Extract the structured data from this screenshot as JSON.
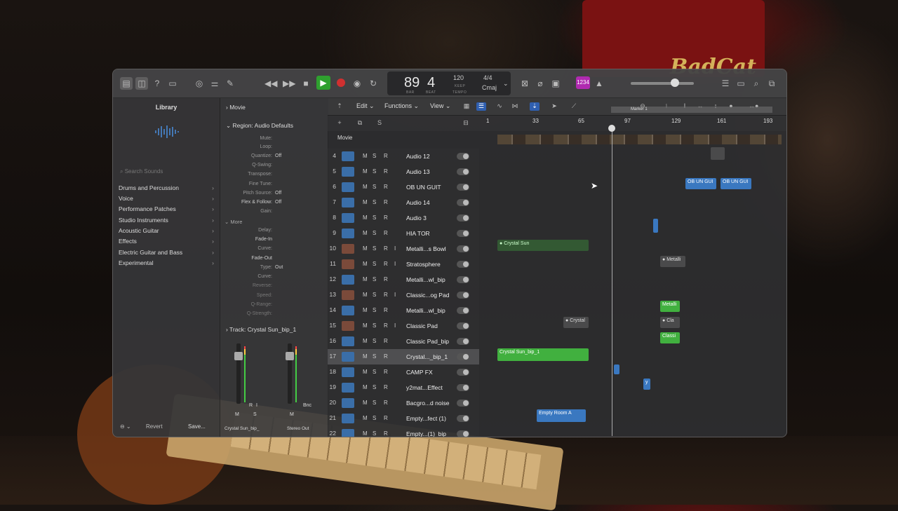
{
  "transport": {
    "bar": "89",
    "beat": "4",
    "bar_caption": "BAR",
    "beat_caption": "BEAT",
    "tempo": "120",
    "keep_label": "KEEP",
    "tempo_caption": "TEMPO",
    "signature": "4/4",
    "key": "Cmaj",
    "badge": "1234"
  },
  "library": {
    "title": "Library",
    "search_placeholder": "Search Sounds",
    "items": [
      "Drums and Percussion",
      "Voice",
      "Performance Patches",
      "Studio Instruments",
      "Acoustic Guitar",
      "Effects",
      "Electric Guitar and Bass",
      "Experimental"
    ],
    "revert": "Revert",
    "save": "Save..."
  },
  "inspector": {
    "movie": "Movie",
    "region": "Region: Audio Defaults",
    "fields": [
      {
        "label": "Mute:",
        "value": ""
      },
      {
        "label": "Loop:",
        "value": ""
      },
      {
        "label": "Quantize:",
        "value": "Off"
      },
      {
        "label": "Q-Swing:",
        "value": ""
      },
      {
        "label": "Transpose:",
        "value": ""
      },
      {
        "label": "Fine Tune:",
        "value": ""
      },
      {
        "label": "Pitch Source:",
        "value": "Off"
      },
      {
        "label": "Flex & Follow:",
        "value": "Off"
      },
      {
        "label": "Gain:",
        "value": ""
      }
    ],
    "more": "More",
    "more_fields": [
      {
        "label": "Delay:",
        "value": ""
      },
      {
        "label": "Fade-In",
        "value": ""
      },
      {
        "label": "Curve:",
        "value": ""
      },
      {
        "label": "Fade-Out",
        "value": ""
      },
      {
        "label": "Type:",
        "value": "Out"
      },
      {
        "label": "Curve:",
        "value": ""
      },
      {
        "label": "Reverse:",
        "value": ""
      },
      {
        "label": "Speed:",
        "value": ""
      },
      {
        "label": "Q-Range:",
        "value": ""
      },
      {
        "label": "Q-Strength:",
        "value": ""
      }
    ],
    "track": "Track:",
    "track_name": "Crystal Sun_bip_1",
    "strip_r": "R",
    "strip_i": "I",
    "strip_m": "M",
    "strip_s": "S",
    "strip_bnc": "Bnc",
    "strip_m2": "M",
    "strip_left_name": "Crystal Sun_bip_",
    "strip_right_name": "Stereo Out"
  },
  "tracks_toolbar": {
    "edit": "Edit",
    "functions": "Functions",
    "view": "View",
    "s": "S"
  },
  "ruler": {
    "marks": [
      "1",
      "33",
      "65",
      "97",
      "129",
      "161",
      "193"
    ],
    "marker": "Marker 1"
  },
  "movie_track": "Movie",
  "tracks": [
    {
      "num": "4",
      "name": "Audio 12",
      "type": "audio",
      "i": false
    },
    {
      "num": "5",
      "name": "Audio 13",
      "type": "audio",
      "i": false
    },
    {
      "num": "6",
      "name": "OB UN GUIT",
      "type": "audio",
      "i": false
    },
    {
      "num": "7",
      "name": "Audio 14",
      "type": "audio",
      "i": false
    },
    {
      "num": "8",
      "name": "Audio 3",
      "type": "audio",
      "i": false
    },
    {
      "num": "9",
      "name": "HIA TOR",
      "type": "audio",
      "i": false
    },
    {
      "num": "10",
      "name": "Metalli...s Bowl",
      "type": "inst",
      "i": true
    },
    {
      "num": "11",
      "name": "Stratosphere",
      "type": "inst",
      "i": true
    },
    {
      "num": "12",
      "name": "Metalli...wl_bip",
      "type": "audio",
      "i": false
    },
    {
      "num": "13",
      "name": "Classic...og Pad",
      "type": "inst",
      "i": true
    },
    {
      "num": "14",
      "name": "Metalli...wl_bip",
      "type": "audio",
      "i": false
    },
    {
      "num": "15",
      "name": "Classic Pad",
      "type": "inst",
      "i": true
    },
    {
      "num": "16",
      "name": "Classic Pad_bip",
      "type": "audio",
      "i": false
    },
    {
      "num": "17",
      "name": "Crystal..._bip_1",
      "type": "audio",
      "i": false
    },
    {
      "num": "18",
      "name": "CAMP FX",
      "type": "audio",
      "i": false
    },
    {
      "num": "19",
      "name": "y2mat...Effect",
      "type": "audio",
      "i": false
    },
    {
      "num": "20",
      "name": "Bacgro...d noise",
      "type": "audio",
      "i": false
    },
    {
      "num": "21",
      "name": "Empty...fect (1)",
      "type": "audio",
      "i": false
    },
    {
      "num": "22",
      "name": "Empty...(1)_bip",
      "type": "audio",
      "i": false
    }
  ],
  "regions": {
    "ob1": "OB UN GUI",
    "ob2": "OB UN GUI",
    "crystal_sun": "Crystal Sun",
    "metalli_a": "Metalli",
    "metalli_b": "Metalli",
    "cla": "Cla",
    "classi": "Classi",
    "crystal": "Crystal",
    "crystal_bip": "Crystal Sun_bip_1",
    "y": "y",
    "empty_room": "Empty Room A"
  }
}
